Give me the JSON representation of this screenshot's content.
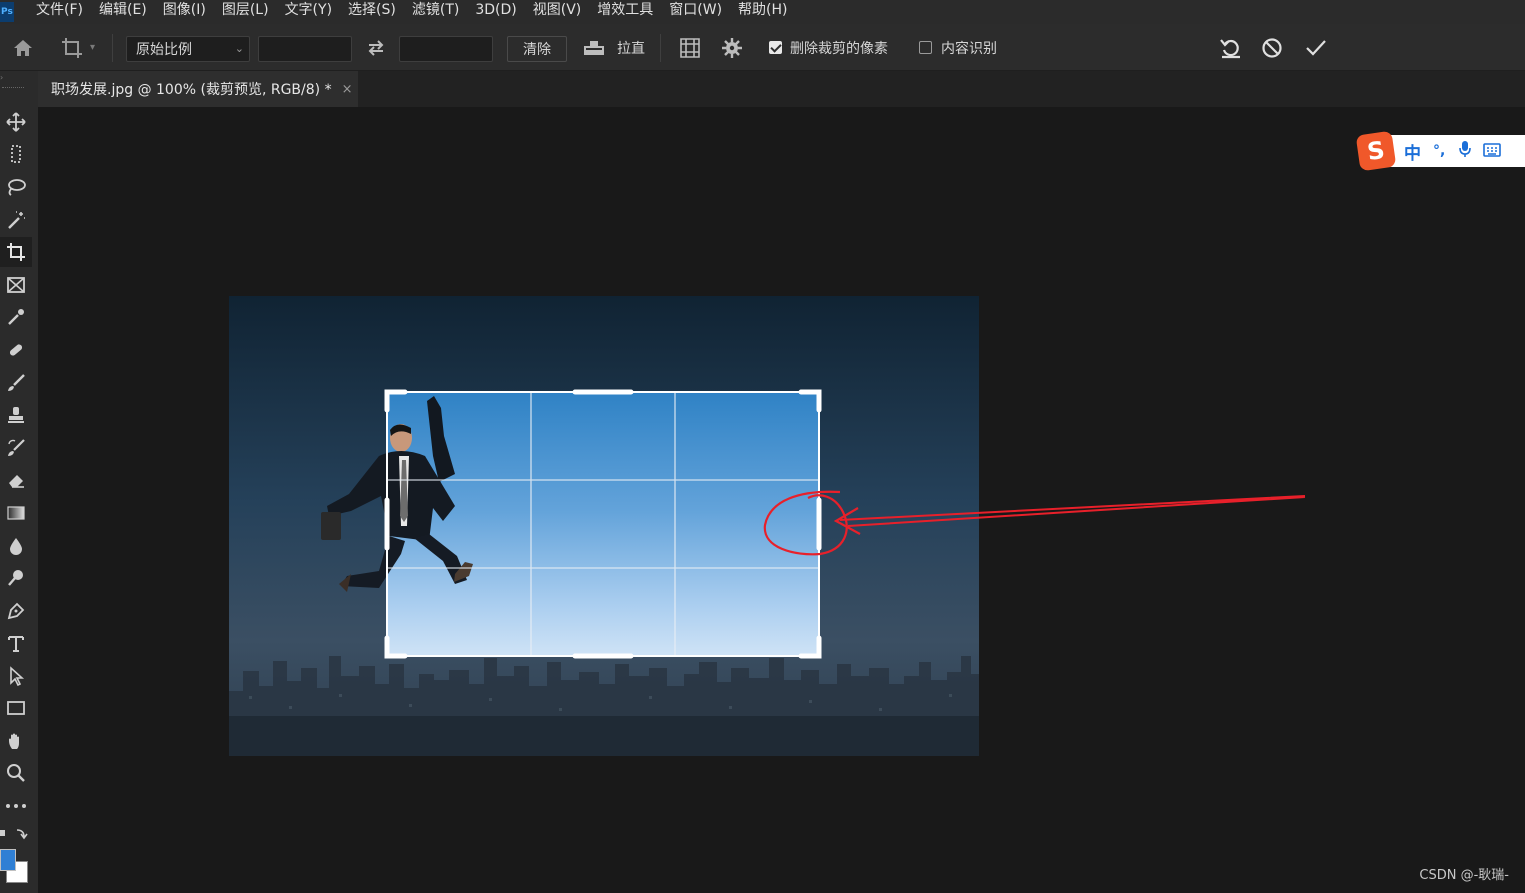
{
  "menu": [
    "文件(F)",
    "编辑(E)",
    "图像(I)",
    "图层(L)",
    "文字(Y)",
    "选择(S)",
    "滤镜(T)",
    "3D(D)",
    "视图(V)",
    "增效工具",
    "窗口(W)",
    "帮助(H)"
  ],
  "app_logo": "Ps",
  "options": {
    "ratio_select": "原始比例",
    "width_value": "",
    "height_value": "",
    "clear_label": "清除",
    "straighten_label": "拉直",
    "delete_cropped_label": "删除裁剪的像素",
    "delete_cropped_checked": true,
    "content_aware_label": "内容识别",
    "content_aware_checked": false
  },
  "document_tab": {
    "title": "职场发展.jpg @ 100% (裁剪预览, RGB/8) *",
    "close": "×"
  },
  "ime": {
    "mode": "中",
    "punct": "°,",
    "logo": "S"
  },
  "watermark": "CSDN @-耿瑞-",
  "colors": {
    "foreground": "#2f7fd4",
    "background": "#ffffff",
    "annotation": "#e8202a"
  },
  "icons": [
    "home-icon",
    "crop-tool-icon",
    "swap-icon",
    "straighten-icon",
    "grid-overlay-icon",
    "settings-icon",
    "reset-icon",
    "cancel-icon",
    "commit-icon"
  ]
}
